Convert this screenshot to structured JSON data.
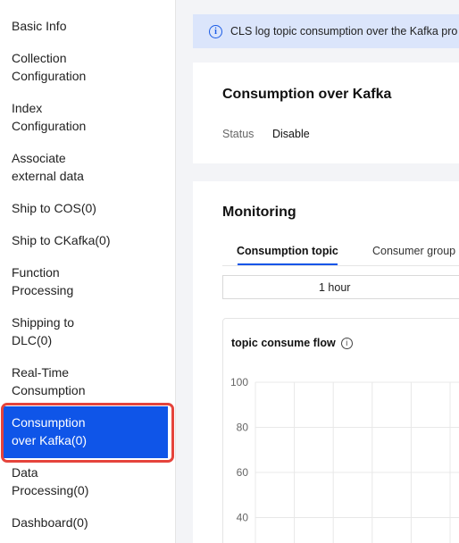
{
  "sidebar": {
    "items": [
      {
        "lines": [
          "Basic Info"
        ]
      },
      {
        "lines": [
          "Collection",
          "Configuration"
        ]
      },
      {
        "lines": [
          "Index",
          "Configuration"
        ]
      },
      {
        "lines": [
          "Associate",
          "external data"
        ]
      },
      {
        "lines": [
          "Ship to COS(0)"
        ]
      },
      {
        "lines": [
          "Ship to CKafka(0)"
        ]
      },
      {
        "lines": [
          "Function",
          "Processing"
        ]
      },
      {
        "lines": [
          "Shipping to",
          "DLC(0)"
        ]
      },
      {
        "lines": [
          "Real-Time",
          "Consumption"
        ]
      },
      {
        "lines": [
          "Consumption",
          "over Kafka(0)"
        ]
      },
      {
        "lines": [
          "Data",
          "Processing(0)"
        ]
      },
      {
        "lines": [
          "Dashboard(0)"
        ]
      }
    ],
    "active_index": 9
  },
  "banner": {
    "icon": "info-icon",
    "text": "CLS log topic consumption over the Kafka pro"
  },
  "kafka_card": {
    "title": "Consumption over Kafka",
    "status_label": "Status",
    "status_value": "Disable"
  },
  "monitoring": {
    "title": "Monitoring",
    "tabs": [
      {
        "label": "Consumption topic",
        "active": true
      },
      {
        "label": "Consumer group",
        "active": false
      }
    ],
    "time_range": "1 hour",
    "chart_title": "topic consume flow"
  },
  "chart_data": {
    "type": "line",
    "title": "topic consume flow",
    "xlabel": "",
    "ylabel": "",
    "y_ticks": [
      "100",
      "80",
      "60",
      "40"
    ],
    "ylim": [
      40,
      100
    ],
    "grid": true,
    "series": []
  },
  "colors": {
    "accent": "#0f55e8",
    "highlight": "#e5443c",
    "banner_bg": "#dbe5fb"
  }
}
